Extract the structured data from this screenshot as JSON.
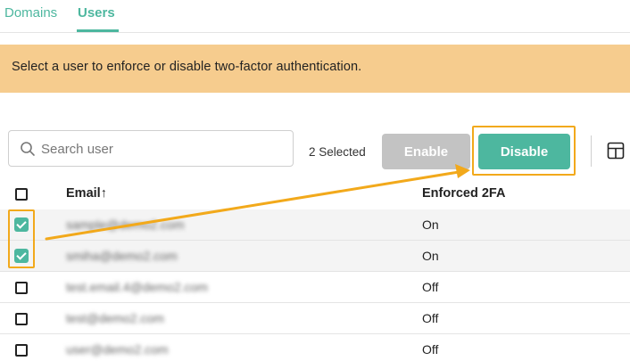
{
  "tabs": [
    {
      "label": "Domains"
    },
    {
      "label": "Users"
    }
  ],
  "banner": {
    "text": "Select a user to enforce or disable two-factor authentication."
  },
  "search": {
    "placeholder": "Search user",
    "value": ""
  },
  "toolbar": {
    "selected_text": "2 Selected",
    "enable_label": "Enable",
    "disable_label": "Disable"
  },
  "table": {
    "headers": {
      "email": "Email↑",
      "twofa": "Enforced 2FA"
    },
    "rows": [
      {
        "email": "sample@demo2.com",
        "twofa": "On",
        "selected": true
      },
      {
        "email": "smiha@demo2.com",
        "twofa": "On",
        "selected": true
      },
      {
        "email": "test.email.4@demo2.com",
        "twofa": "Off",
        "selected": false
      },
      {
        "email": "test@demo2.com",
        "twofa": "Off",
        "selected": false
      },
      {
        "email": "user@demo2.com",
        "twofa": "Off",
        "selected": false
      }
    ]
  },
  "colors": {
    "accent": "#4db79f",
    "banner": "#f6cc8e",
    "annotation": "#f2a91b",
    "disabled_button": "#c3c3c3"
  },
  "icons": {
    "search": "search-icon",
    "columns": "table-columns-icon"
  }
}
